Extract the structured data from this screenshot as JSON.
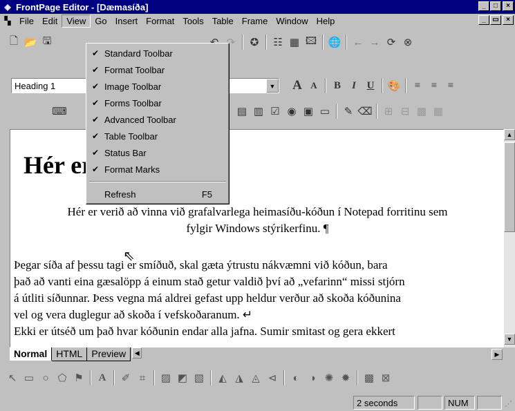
{
  "window": {
    "title": "FrontPage Editor - [Dæmasíða]",
    "minimize": "_",
    "maximize": "□",
    "close": "×"
  },
  "menu": {
    "items": [
      "File",
      "Edit",
      "View",
      "Go",
      "Insert",
      "Format",
      "Tools",
      "Table",
      "Frame",
      "Window",
      "Help"
    ],
    "doc_min": "_",
    "doc_restore": "▭",
    "doc_close": "×"
  },
  "view_menu": {
    "items": [
      {
        "label": "Standard Toolbar",
        "checked": true
      },
      {
        "label": "Format Toolbar",
        "checked": true
      },
      {
        "label": "Image Toolbar",
        "checked": true
      },
      {
        "label": "Forms Toolbar",
        "checked": true
      },
      {
        "label": "Advanced Toolbar",
        "checked": true
      },
      {
        "label": "Table Toolbar",
        "checked": true
      },
      {
        "label": "Status Bar",
        "checked": true
      },
      {
        "label": "Format Marks",
        "checked": true
      }
    ],
    "refresh": {
      "label": "Refresh",
      "shortcut": "F5"
    },
    "check_glyph": "✔"
  },
  "format_toolbar": {
    "style_value": "Heading 1",
    "bold": "B",
    "italic": "I",
    "underline": "U",
    "grow_font": "A",
    "shrink_font": "A"
  },
  "document": {
    "heading": "Hér er dæmasíða¶",
    "paragraph1_line1": "Hér er verið að vinna við grafalvarlega heimasíðu-kóðun í Notepad forritinu sem",
    "paragraph1_line2": "fylgir Windows stýrikerfinu. ¶",
    "paragraph2_line1": "Þegar síða af þessu tagi er smíðuð, skal gæta ýtrustu nákvæmni við kóðun, bara",
    "paragraph2_line2": "það að vanti eina gæsalöpp á einum stað getur valdið því að „vefarinn“ missi stjórn",
    "paragraph2_line3": "á útliti síðunnar. Þess vegna má aldrei gefast upp heldur verður að skoða kóðunina",
    "paragraph2_line4": "vel og vera duglegur að skoða í vefskoðaranum. ↵",
    "paragraph3_line1": "Ekki er útséð um það hvar kóðunin endar alla jafna. Sumir smitast og gera ekkert"
  },
  "tabs": [
    "Normal",
    "HTML",
    "Preview"
  ],
  "statusbar": {
    "load_time": "2 seconds",
    "num": "NUM"
  }
}
